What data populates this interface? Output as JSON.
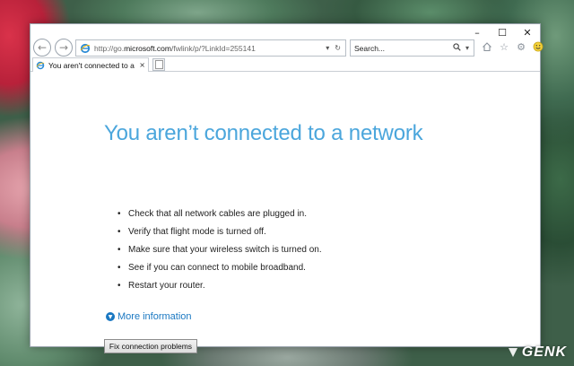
{
  "window": {
    "caption": {
      "minimize": "–",
      "maximize": "☐",
      "close": "✕"
    }
  },
  "toolbar": {
    "back_icon": "back-arrow-icon",
    "forward_icon": "forward-arrow-icon",
    "address": {
      "prefix": "http://go.",
      "host": "microsoft.com",
      "path": "/fwlink/p/?LinkId=255141"
    },
    "search": {
      "value": "Search..."
    },
    "icons": [
      "home-icon",
      "favorites-star-icon",
      "settings-gear-icon",
      "smiley-feedback-icon"
    ]
  },
  "tab": {
    "label": "You aren't connected to a n...",
    "close": "×"
  },
  "page": {
    "title": "You aren’t connected to a network",
    "tips": [
      "Check that all network cables are plugged in.",
      "Verify that flight mode is turned off.",
      "Make sure that your wireless switch is turned on.",
      "See if you can connect to mobile broadband.",
      "Restart your router."
    ],
    "more_info_label": "More information",
    "fix_button_label": "Fix connection problems"
  },
  "watermark": {
    "text": "GENK"
  },
  "colors": {
    "title_blue": "#4ba6dc",
    "link_blue": "#1a78c2"
  }
}
